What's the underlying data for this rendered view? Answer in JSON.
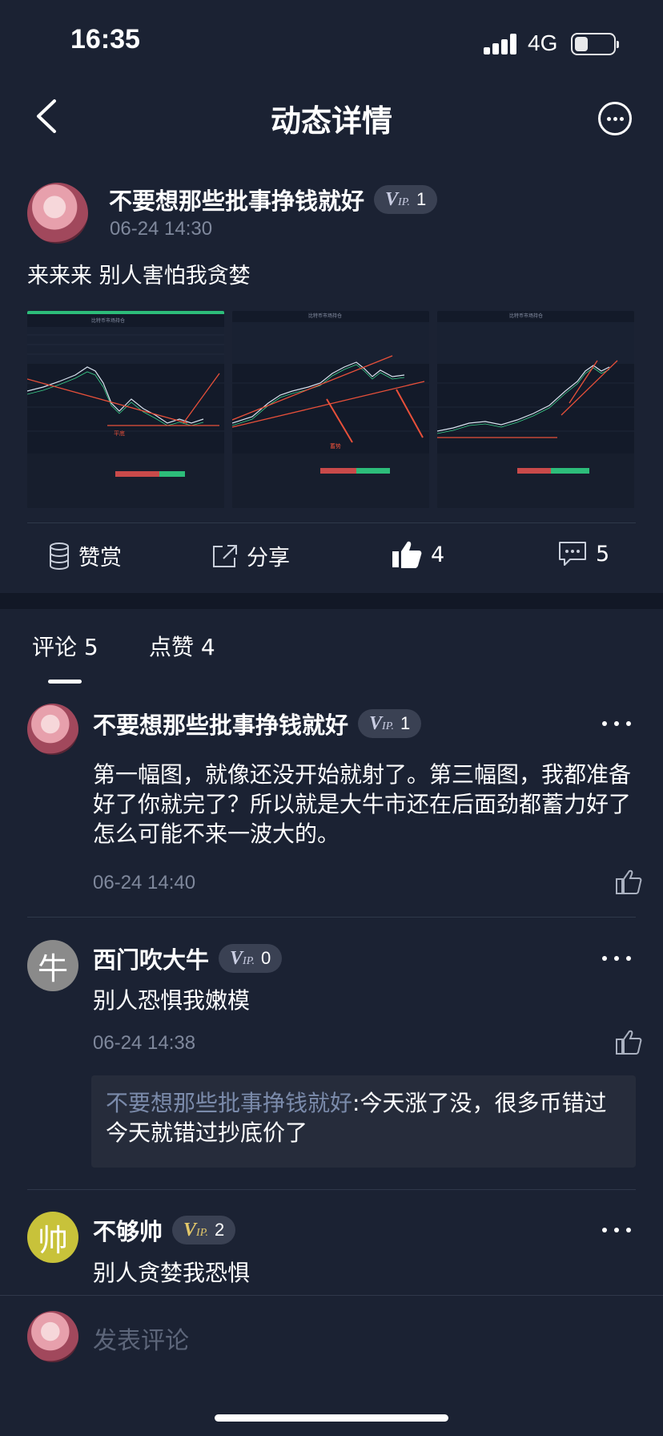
{
  "status": {
    "time": "16:35",
    "network": "4G"
  },
  "nav": {
    "title": "动态详情"
  },
  "post": {
    "author": "不要想那些批事挣钱就好",
    "vip_level": "1",
    "time": "06-24 14:30",
    "text": "来来来 别人害怕我贪婪",
    "charts": [
      {
        "title": "比特币市场持仓",
        "label": "平底"
      },
      {
        "title": "比特币市场持仓",
        "label": "蓄势"
      },
      {
        "title": "比特币市场持仓",
        "label": ""
      }
    ],
    "actions": {
      "reward": "赞赏",
      "share": "分享",
      "likes": "4",
      "comments": "5"
    }
  },
  "tabs": {
    "comments": "评论 5",
    "likes": "点赞 4"
  },
  "comments": [
    {
      "author": "不要想那些批事挣钱就好",
      "vip_level": "1",
      "text": "第一幅图，就像还没开始就射了。第三幅图，我都准备好了你就完了？所以就是大牛市还在后面劲都蓄力好了怎么可能不来一波大的。",
      "time": "06-24 14:40"
    },
    {
      "author": "西门吹大牛",
      "avatar_letter": "牛",
      "avatar_color": "#8a8a8a",
      "vip_level": "0",
      "text": "别人恐惧我嫩模",
      "time": "06-24 14:38",
      "reply": {
        "user": "不要想那些批事挣钱就好",
        "text": ":今天涨了没，很多币错过今天就错过抄底价了"
      }
    },
    {
      "author": "不够帅",
      "avatar_letter": "帅",
      "avatar_color": "#c8c23a",
      "vip_level": "2",
      "text": "别人贪婪我恐惧"
    }
  ],
  "composer": {
    "placeholder": "发表评论"
  },
  "colors": {
    "background": "#1b2233",
    "accent_red": "#e8503a",
    "vip_gold": "#e3c86a"
  }
}
